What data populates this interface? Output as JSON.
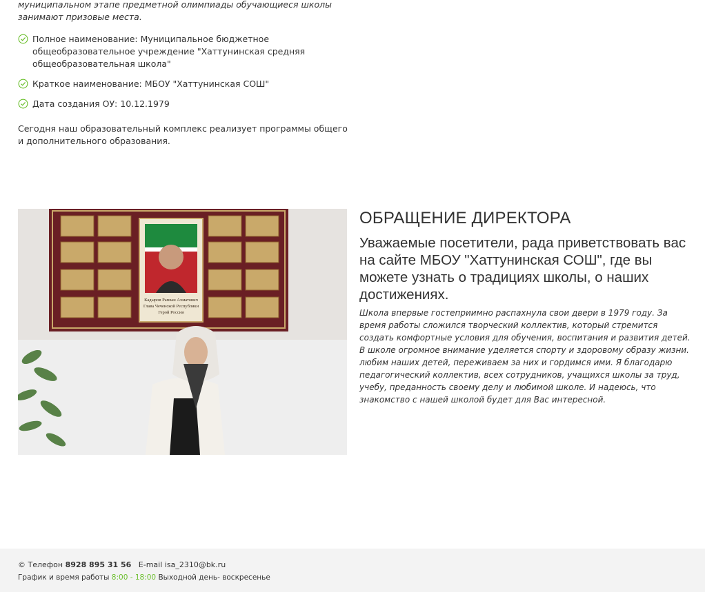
{
  "intro": {
    "tail": "муниципальном этапе предметной олимпиады обучающиеся школы занимают призовые места.",
    "items": [
      "Полное наименование: Муниципальное бюджетное общеобразовательное учреждение \"Хаттунинская средняя общеобразовательная школа\"",
      "Краткое наименование: МБОУ \"Хаттунинская СОШ\"",
      "Дата создания ОУ: 10.12.1979"
    ],
    "paragraph": "Сегодня наш образовательный комплекс реализует программы общего и дополнительного образования."
  },
  "photo": {
    "portrait_caption_1": "Кадыров Рамзан Ахматович",
    "portrait_caption_2": "Глава Чеченской Республики",
    "portrait_caption_3": "Герой России"
  },
  "director": {
    "heading": "ОБРАЩЕНИЕ ДИРЕКТОРА",
    "greeting": "Уважаемые посетители, рада приветствовать вас на сайте МБОУ \"Хаттунинская СОШ\", где вы можете узнать о традициях школы, о наших достижениях.",
    "letter_p1": "Школа впервые гостеприимно распахнула свои двери в 1979 году. За время работы сложился творческий коллектив, который стремится создать комфортные условия для обучения, воспитания и развития детей. В школе огромное внимание уделяется спорту и здоровому образу жизни.",
    "letter_p2": "любим наших детей, переживаем за них и гордимся ими. Я благодарю педагогический коллектив, всех сотрудников, учащихся школы за труд, учебу, преданность своему делу и любимой школе. И надеюсь, что знакомство с нашей школой будет для Вас интересной."
  },
  "footer": {
    "phone_label": "© Телефон",
    "phone": "8928 895 31 56",
    "email_label": "E-mail",
    "email": "isa_2310@bk.ru",
    "hours_label": "График и время работы",
    "hours": "8:00 - 18:00",
    "day_off": "Выходной день- воскресенье"
  },
  "colors": {
    "accent_green": "#6cbf2e",
    "footer_bg": "#f3f3f3",
    "text": "#333333"
  }
}
